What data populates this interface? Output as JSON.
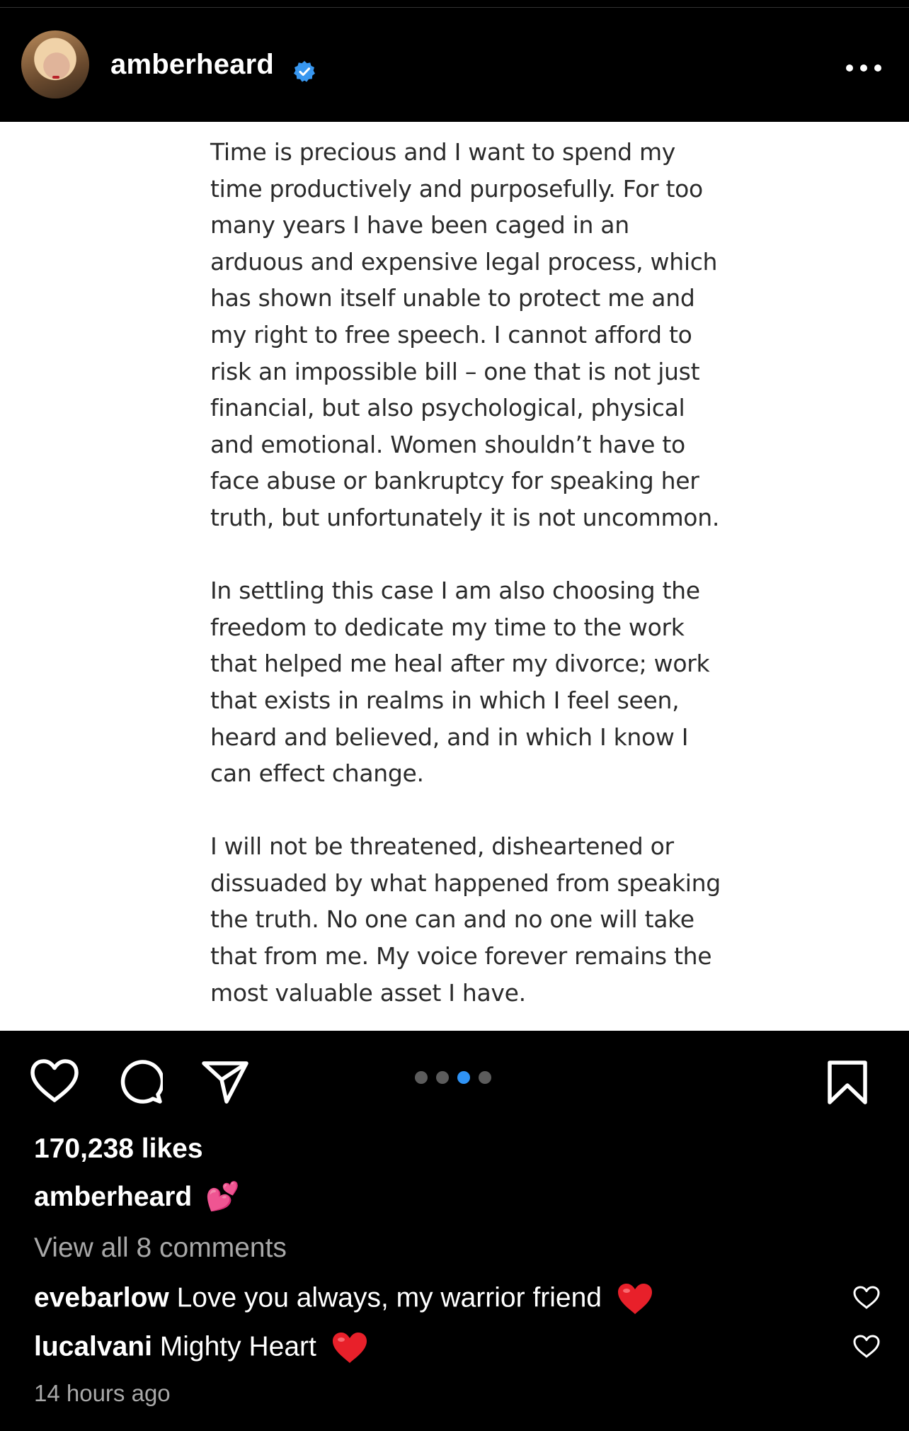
{
  "header": {
    "username": "amberheard",
    "verified": true,
    "avatar_icon": "profile-photo",
    "more_icon": "more-horizontal-icon"
  },
  "post": {
    "paragraphs": [
      "Time is precious and I want to spend my\ntime productively and purposefully. For too\nmany years I have been caged in an\narduous and expensive legal process, which\nhas shown itself unable to protect me and\nmy right to free speech. I cannot afford to\nrisk an impossible bill – one that is not just\nfinancial, but also psychological, physical\nand emotional. Women shouldn’t have to\nface abuse or bankruptcy for speaking her\ntruth, but unfortunately it is not uncommon.",
      "In settling this case I am also choosing the\nfreedom to dedicate my time to the work\nthat helped me heal after my divorce; work\nthat exists in realms in which I feel seen,\nheard and believed, and in which I know I\ncan effect change.",
      "I will not be threatened, disheartened or\ndissuaded by what happened from speaking\nthe truth. No one can and no one will take\nthat from me.  My voice forever remains the\nmost valuable asset I have."
    ],
    "carousel": {
      "total": 4,
      "active_index": 2
    }
  },
  "actions": {
    "like_icon": "heart-icon",
    "comment_icon": "comment-icon",
    "share_icon": "send-icon",
    "save_icon": "bookmark-icon"
  },
  "meta": {
    "likes": "170,238 likes",
    "caption_user": "amberheard",
    "caption_text": "💕",
    "view_all": "View all 8 comments",
    "comments": [
      {
        "user": "evebarlow",
        "text": "Love you always, my warrior friend"
      },
      {
        "user": "lucalvani",
        "text": "Mighty Heart"
      }
    ],
    "time": "14 hours ago"
  },
  "colors": {
    "background": "#000000",
    "verified": "#3897f0",
    "carousel_active": "#2f93f5",
    "muted_text": "#a8a8a8",
    "heart_red": "#e8202a",
    "caption_hearts": "#e23ea8"
  }
}
